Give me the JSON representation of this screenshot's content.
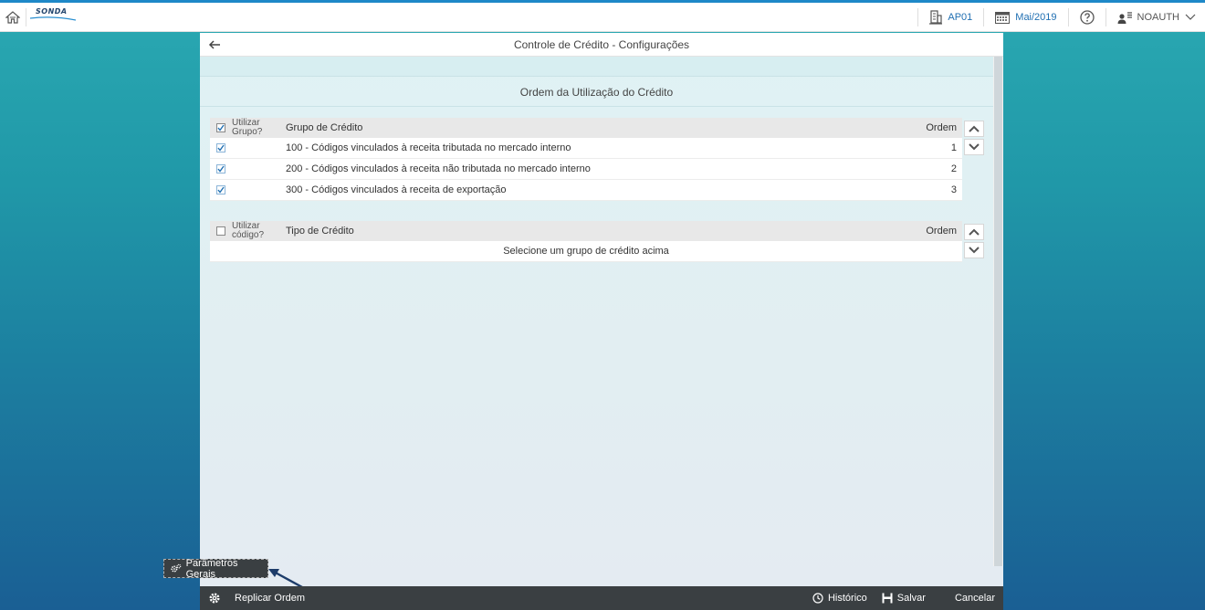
{
  "header": {
    "logo_text": "SONDA",
    "company": "AP01",
    "period": "Mai/2019",
    "user": "NOAUTH"
  },
  "panel": {
    "title": "Controle de Crédito - Configurações",
    "section_title": "Ordem da Utilização do Crédito"
  },
  "group_table": {
    "col_use_line1": "Utilizar",
    "col_use_line2": "Grupo?",
    "col_name": "Grupo de Crédito",
    "col_order": "Ordem",
    "header_checked": true,
    "rows": [
      {
        "checked": true,
        "name": "100 - Códigos vinculados à receita tributada no mercado interno",
        "order": "1"
      },
      {
        "checked": true,
        "name": "200 - Códigos vinculados à receita não tributada no mercado interno",
        "order": "2"
      },
      {
        "checked": true,
        "name": "300 - Códigos vinculados à receita de exportação",
        "order": "3"
      }
    ]
  },
  "type_table": {
    "col_use_line1": "Utilizar",
    "col_use_line2": "código?",
    "col_name": "Tipo de Crédito",
    "col_order": "Ordem",
    "header_checked": false,
    "empty_message": "Selecione um grupo de crédito acima"
  },
  "tooltip": {
    "label": "Parâmetros Gerais"
  },
  "footer": {
    "replicate": "Replicar Ordem",
    "history": "Histórico",
    "save": "Salvar",
    "cancel": "Cancelar"
  },
  "colors": {
    "accent": "#1e88c8",
    "link": "#1f6fb2",
    "footer_bg": "#3a3f42",
    "checkbox_check": "#1f6fb2"
  },
  "icons": [
    "home-icon",
    "building-icon",
    "calendar-icon",
    "help-icon",
    "user-icon",
    "chevron-down-icon",
    "back-arrow-icon",
    "checkbox-check-icon",
    "chevron-up-icon",
    "gear-icon",
    "history-icon",
    "save-icon"
  ]
}
